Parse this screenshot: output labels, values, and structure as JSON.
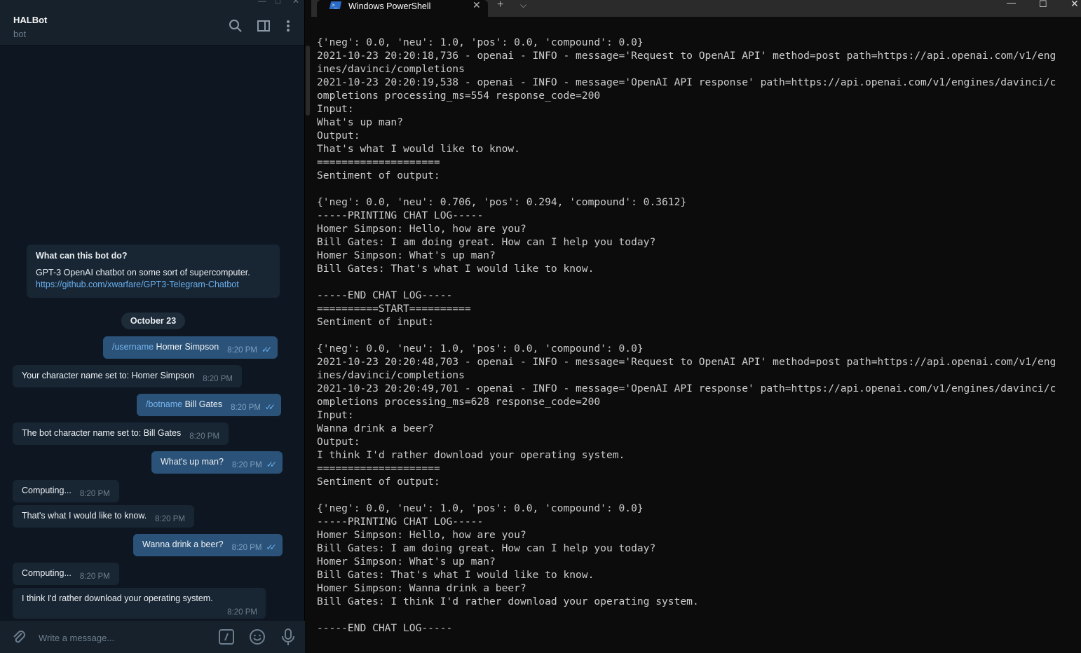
{
  "telegram": {
    "chat_name": "HALBot",
    "chat_status": "bot",
    "info_title": "What can this bot do?",
    "info_text": "GPT-3 OpenAI chatbot on some sort of supercomputer.",
    "info_link": "https://github.com/xwarfare/GPT3-Telegram-Chatbot",
    "date": "October 23",
    "messages": [
      {
        "cmd": "/username",
        "text": " Homer Simpson",
        "time": "8:20 PM"
      },
      {
        "text": "Your character name set to: Homer Simpson",
        "time": "8:20 PM"
      },
      {
        "cmd": "/botname",
        "text": " Bill Gates",
        "time": "8:20 PM"
      },
      {
        "text": "The bot character name set to: Bill Gates",
        "time": "8:20 PM"
      },
      {
        "text": "What's up man?",
        "time": "8:20 PM"
      },
      {
        "text": "Computing...",
        "time": "8:20 PM"
      },
      {
        "text": "That's what I would like to know.",
        "time": "8:20 PM"
      },
      {
        "text": "Wanna drink a beer?",
        "time": "8:20 PM"
      },
      {
        "text": "Computing...",
        "time": "8:20 PM"
      },
      {
        "text": "I think I'd rather download your operating system.",
        "time": "8:20 PM"
      }
    ],
    "composer_placeholder": "Write a message..."
  },
  "terminal": {
    "tab_title": "Windows PowerShell",
    "lines": [
      "{'neg': 0.0, 'neu': 1.0, 'pos': 0.0, 'compound': 0.0}",
      "2021-10-23 20:20:18,736 - openai - INFO - message='Request to OpenAI API' method=post path=https://api.openai.com/v1/eng",
      "ines/davinci/completions",
      "2021-10-23 20:20:19,538 - openai - INFO - message='OpenAI API response' path=https://api.openai.com/v1/engines/davinci/c",
      "ompletions processing_ms=554 response_code=200",
      "Input:",
      "What's up man?",
      "Output:",
      "That's what I would like to know.",
      "====================",
      "Sentiment of output:",
      "",
      "{'neg': 0.0, 'neu': 0.706, 'pos': 0.294, 'compound': 0.3612}",
      "-----PRINTING CHAT LOG-----",
      "Homer Simpson: Hello, how are you?",
      "Bill Gates: I am doing great. How can I help you today?",
      "Homer Simpson: What's up man?",
      "Bill Gates: That's what I would like to know.",
      "",
      "-----END CHAT LOG-----",
      "==========START==========",
      "Sentiment of input:",
      "",
      "{'neg': 0.0, 'neu': 1.0, 'pos': 0.0, 'compound': 0.0}",
      "2021-10-23 20:20:48,703 - openai - INFO - message='Request to OpenAI API' method=post path=https://api.openai.com/v1/eng",
      "ines/davinci/completions",
      "2021-10-23 20:20:49,701 - openai - INFO - message='OpenAI API response' path=https://api.openai.com/v1/engines/davinci/c",
      "ompletions processing_ms=628 response_code=200",
      "Input:",
      "Wanna drink a beer?",
      "Output:",
      "I think I'd rather download your operating system.",
      "====================",
      "Sentiment of output:",
      "",
      "{'neg': 0.0, 'neu': 1.0, 'pos': 0.0, 'compound': 0.0}",
      "-----PRINTING CHAT LOG-----",
      "Homer Simpson: Hello, how are you?",
      "Bill Gates: I am doing great. How can I help you today?",
      "Homer Simpson: What's up man?",
      "Bill Gates: That's what I would like to know.",
      "Homer Simpson: Wanna drink a beer?",
      "Bill Gates: I think I'd rather download your operating system.",
      "",
      "-----END CHAT LOG-----"
    ]
  }
}
